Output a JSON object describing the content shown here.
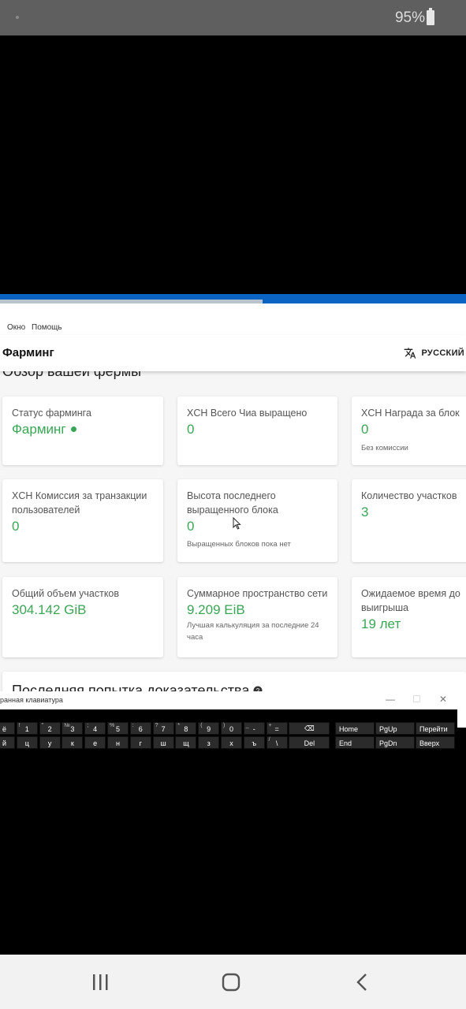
{
  "status_bar": {
    "battery_text": "95%"
  },
  "app": {
    "menu": [
      "Окно",
      "Помощь"
    ],
    "title": "Фарминг",
    "language": "РУССКИЙ",
    "overview_heading": "Обзор вашей фермы",
    "cards": [
      {
        "label": "Статус фарминга",
        "value": "Фарминг",
        "sub": ""
      },
      {
        "label": "XCH Всего Чиа выращено",
        "value": "0",
        "sub": ""
      },
      {
        "label": "XCH Награда за блок",
        "value": "0",
        "sub": "Без комиссии"
      },
      {
        "label": "XCH Комиссия за транзакции пользователей",
        "value": "0",
        "sub": ""
      },
      {
        "label": "Высота последнего выращенного блока",
        "value": "0",
        "sub": "Выращенных блоков пока нет"
      },
      {
        "label": "Количество участков",
        "value": "3",
        "sub": ""
      },
      {
        "label": "Общий объем участков",
        "value": "304.142 GiB",
        "sub": ""
      },
      {
        "label": "Суммарное пространство сети",
        "value": "9.209 EiB",
        "sub": "Лучшая калькуляция за последние 24 часа"
      },
      {
        "label": "Ожидаемое время до выигрыша",
        "value": "19 лет",
        "sub": ""
      }
    ],
    "proof_heading": "Последняя попытка доказательства"
  },
  "keyboard": {
    "title": "ранная клавиатура",
    "row1": [
      {
        "s": "",
        "m": "ё"
      },
      {
        "s": "!",
        "m": "1"
      },
      {
        "s": "\"",
        "m": "2"
      },
      {
        "s": "№",
        "m": "3"
      },
      {
        "s": ";",
        "m": "4"
      },
      {
        "s": "%",
        "m": "5"
      },
      {
        "s": ":",
        "m": "6"
      },
      {
        "s": "?",
        "m": "7"
      },
      {
        "s": "*",
        "m": "8"
      },
      {
        "s": "(",
        "m": "9"
      },
      {
        "s": ")",
        "m": "0"
      },
      {
        "s": "_",
        "m": "-"
      },
      {
        "s": "+",
        "m": "="
      },
      {
        "s": "",
        "m": "⌫"
      }
    ],
    "row2": [
      {
        "s": "",
        "m": "й"
      },
      {
        "s": "",
        "m": "ц"
      },
      {
        "s": "",
        "m": "у"
      },
      {
        "s": "",
        "m": "к"
      },
      {
        "s": "",
        "m": "е"
      },
      {
        "s": "",
        "m": "н"
      },
      {
        "s": "",
        "m": "г"
      },
      {
        "s": "",
        "m": "ш"
      },
      {
        "s": "",
        "m": "щ"
      },
      {
        "s": "",
        "m": "з"
      },
      {
        "s": "",
        "m": "х"
      },
      {
        "s": "",
        "m": "ъ"
      },
      {
        "s": "/",
        "m": "\\"
      },
      {
        "s": "",
        "m": "Del"
      }
    ],
    "nav1": [
      "Home",
      "PgUp",
      "Перейти"
    ],
    "nav2": [
      "End",
      "PgDn",
      "Вверх"
    ]
  }
}
